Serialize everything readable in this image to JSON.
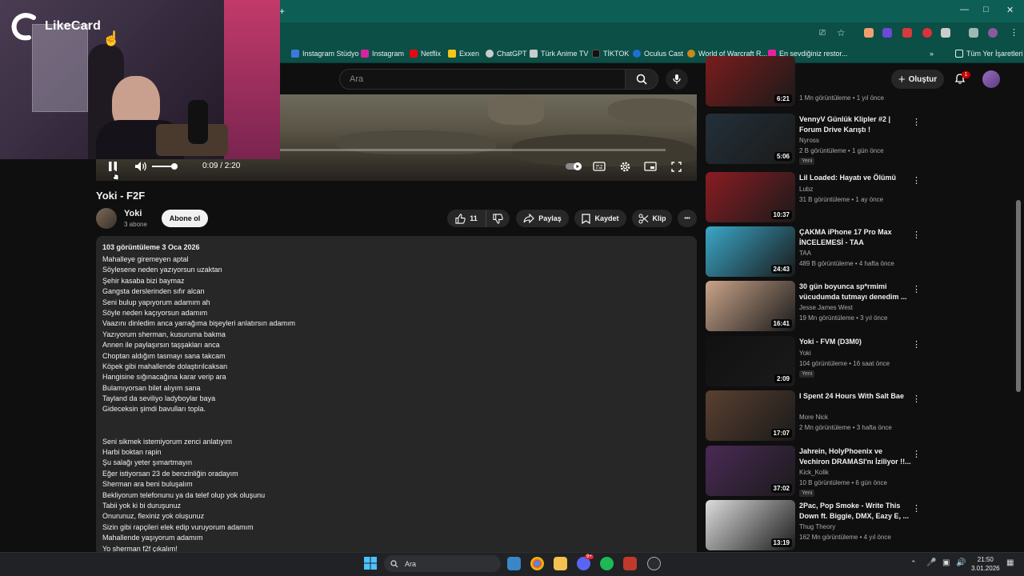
{
  "browser": {
    "new_tab_label": "+",
    "bookmarks": [
      {
        "label": "Instagram Stüdyo",
        "color": "#3b7bd6"
      },
      {
        "label": "Instagram",
        "color": "#d6249f"
      },
      {
        "label": "Netflix",
        "color": "#e50914"
      },
      {
        "label": "Exxen",
        "color": "#f5c518"
      },
      {
        "label": "ChatGPT",
        "color": "#cccccc"
      },
      {
        "label": "Türk Anime TV",
        "color": "#cccccc"
      },
      {
        "label": "TİKTOK",
        "color": "#111111"
      },
      {
        "label": "Oculus Cast",
        "color": "#1f6fd1"
      },
      {
        "label": "World of Warcraft R...",
        "color": "#c98a18"
      },
      {
        "label": "En sevdiğiniz restor...",
        "color": "#e4239c"
      }
    ],
    "bookmark_overflow": "»",
    "all_bookmarks": "Tüm Yer İşaretleri"
  },
  "webcam": {
    "logo_text": "LikeCard"
  },
  "youtube_header": {
    "search_placeholder": "Ara",
    "create_label": "Oluştur",
    "notification_count": "1"
  },
  "player": {
    "time_current": "0:09",
    "time_total": "2:20",
    "time_display": "0:09 / 2:20",
    "progress_fraction": 0.064,
    "volume_fraction": 1.0
  },
  "video": {
    "title": "Yoki - F2F",
    "channel_name": "Yoki",
    "channel_subs": "3 abone",
    "subscribe_label": "Abone ol",
    "likes": "11",
    "share_label": "Paylaş",
    "save_label": "Kaydet",
    "clip_label": "Klip",
    "more_label": "•••"
  },
  "description": {
    "meta": "103 görüntüleme  3 Oca 2026",
    "lines": [
      "Mahalleye giremeyen aptal",
      "Söylesene neden yazıyorsun uzaktan",
      "Şehir kasaba bizi baymaz",
      "Gangsta derslerinden sıfır alcan",
      "Seni bulup yapıyorum adamım ah",
      "Söyle neden kaçıyorsun adamım",
      "Vaazını dinledim anca yarrağıma bişeyleri anlatırsın adamım",
      "Yazıyorum sherman, kusuruma bakma",
      "Annen ile paylaşırsın taşşakları anca",
      "Choptan aldığım tasmayı sana takcam",
      "Köpek gibi mahallende dolaştırılcaksan",
      "Hangisine sığınacağına karar verip ara",
      "Bulamıyorsan bilet alıyım sana",
      "Tayland da seviliyo ladyboylar baya",
      "Gideceksin şimdi bavulları topla.",
      "",
      "",
      "Seni sikmek istemiyorum zenci anlatıyım",
      "Harbi boktan rapin",
      "Şu salağı yeter şımartmayın",
      "Eğer istiyorsan 23 de benzinliğin oradayım",
      "Sherman ara beni buluşalım",
      "Bekliyorum telefonunu ya da telef olup yok oluşunu",
      "Tabii yok ki bi duruşunuz",
      "Onurunuz, flexiniz yok oluşunuz",
      "Sizin gibi rapçileri elek edip vuruyorum adamım",
      "Mahallende yaşıyorum adamım",
      "Yo sherman f2f çıkalım!"
    ]
  },
  "recommendations": [
    {
      "title": "",
      "channel": "",
      "meta": "1 Mn görüntüleme • 1 yıl önce",
      "duration": "6:21",
      "badge": "",
      "thumb_color": "#7a1c1c"
    },
    {
      "title": "VennyV Günlük Klipler #2 | Forum Drive Karıştı !",
      "channel": "Nyross",
      "meta": "2 B görüntüleme • 1 gün önce",
      "duration": "5:06",
      "badge": "Yeni",
      "thumb_color": "#23303a"
    },
    {
      "title": "Lil Loaded: Hayatı ve Ölümü",
      "channel": "Lubz",
      "meta": "31 B görüntüleme • 1 ay önce",
      "duration": "10:37",
      "badge": "",
      "thumb_color": "#8a1c22"
    },
    {
      "title": "ÇAKMA iPhone 17 Pro Max İNCELEMESİ - TAA",
      "channel": "TAA",
      "meta": "489 B görüntüleme • 4 hafta önce",
      "duration": "24:43",
      "badge": "",
      "thumb_color": "#3aa7c8"
    },
    {
      "title": "30 gün boyunca sp*rmimi vücudumda tutmayı denedim ...",
      "channel": "Jesse James West",
      "meta": "19 Mn görüntüleme • 3 yıl önce",
      "duration": "16:41",
      "badge": "",
      "thumb_color": "#c9a48a"
    },
    {
      "title": "Yoki - FVM (D3M0)",
      "channel": "Yoki",
      "meta": "104 görüntüleme • 16 saat önce",
      "duration": "2:09",
      "badge": "Yeni",
      "thumb_color": "#111111"
    },
    {
      "title": "I Spent 24 Hours With Salt Bae",
      "channel": "More Nick",
      "meta": "2 Mn görüntüleme • 3 hafta önce",
      "duration": "17:07",
      "badge": "",
      "thumb_color": "#5a4030"
    },
    {
      "title": "Jahrein, HolyPhoenix ve Vechiron DRAMASI'nı İziliyor !!...",
      "channel": "Kick_Kolik",
      "meta": "10 B görüntüleme • 6 gün önce",
      "duration": "37:02",
      "badge": "Yeni",
      "thumb_color": "#4a2a55"
    },
    {
      "title": "2Pac, Pop Smoke - Write This Down ft. Biggie, DMX, Eazy E, ...",
      "channel": "Thug Theory",
      "meta": "162 Mn görüntüleme • 4 yıl önce",
      "duration": "13:19",
      "badge": "",
      "thumb_color": "#dddddd"
    }
  ],
  "taskbar": {
    "search_label": "Ara",
    "discord_badge": "9+",
    "time": "21:50",
    "date": "3.01.2026"
  }
}
